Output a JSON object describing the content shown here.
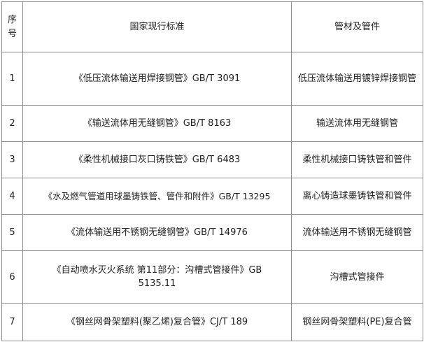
{
  "table": {
    "headers": {
      "index": "序号",
      "standard": "国家现行标准",
      "pipe": "管材及管件"
    },
    "rows": [
      {
        "index": "1",
        "standard": "《低压流体输送用焊接钢管》GB/T 3091",
        "pipe": "低压流体输送用镀锌焊接钢管"
      },
      {
        "index": "2",
        "standard": "《输送流体用无缝钢管》GB/T 8163",
        "pipe": "输送流体用无缝钢管"
      },
      {
        "index": "3",
        "standard": "《柔性机械接口灰口铸铁管》GB/T 6483",
        "pipe": "柔性机械接口铸铁管和管件"
      },
      {
        "index": "4",
        "standard": "《水及燃气管道用球墨铸铁管、管件和附件》GB/T 13295",
        "pipe": "离心铸造球墨铸铁管和管件"
      },
      {
        "index": "5",
        "standard": "《流体输送用不锈钢无缝钢管》GB/T 14976",
        "pipe": "流体输送用不锈钢无缝钢管"
      },
      {
        "index": "6",
        "standard": "《自动喷水灭火系统 第11部分：沟槽式管接件》GB 5135.11",
        "pipe": "沟槽式管接件"
      },
      {
        "index": "7",
        "standard": "《钢丝网骨架塑料(聚乙烯)复合管》CJ/T 189",
        "pipe": "钢丝网骨架塑料(PE)复合管"
      }
    ]
  }
}
